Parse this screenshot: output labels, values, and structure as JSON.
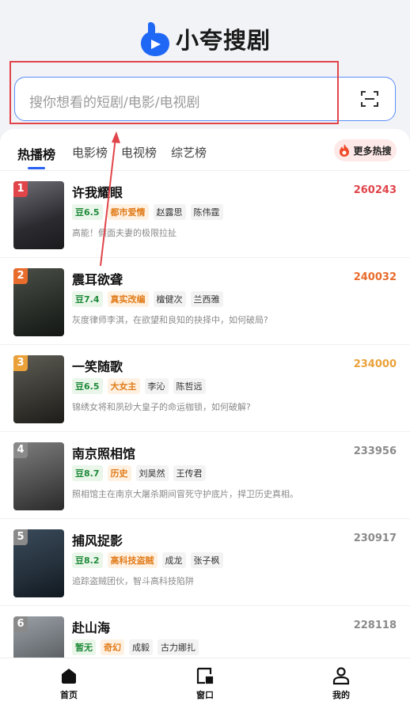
{
  "app": {
    "title": "小夸搜剧",
    "search_placeholder": "搜你想看的短剧/电影/电视剧"
  },
  "tabs": [
    {
      "label": "热播榜",
      "active": true
    },
    {
      "label": "电影榜",
      "active": false
    },
    {
      "label": "电视榜",
      "active": false
    },
    {
      "label": "综艺榜",
      "active": false
    }
  ],
  "more_hot_label": "更多热搜",
  "rank_colors": [
    "#e0454a",
    "#e86c2c",
    "#eaa13a",
    "#8a8a8a",
    "#8a8a8a",
    "#8a8a8a"
  ],
  "items": [
    {
      "rank": "1",
      "title": "许我耀眼",
      "score": "260243",
      "douban": "豆6.5",
      "genre": "都市爱情",
      "actors": [
        "赵露思",
        "陈伟霆"
      ],
      "desc": "高能！假面夫妻的极限拉扯",
      "score_color": "#e0454a"
    },
    {
      "rank": "2",
      "title": "震耳欲聋",
      "score": "240032",
      "douban": "豆7.4",
      "genre": "真实改编",
      "actors": [
        "檀健次",
        "兰西雅"
      ],
      "desc": "灰度律师李淇，在欲望和良知的抉择中，如何破局?",
      "score_color": "#e86c2c"
    },
    {
      "rank": "3",
      "title": "一笑随歌",
      "score": "234000",
      "douban": "豆6.5",
      "genre": "大女主",
      "actors": [
        "李沁",
        "陈哲远"
      ],
      "desc": "锦绣女将和夙砂大皇子的命运枷锁，如何破解?",
      "score_color": "#eaa13a"
    },
    {
      "rank": "4",
      "title": "南京照相馆",
      "score": "233956",
      "douban": "豆8.7",
      "genre": "历史",
      "actors": [
        "刘昊然",
        "王传君"
      ],
      "desc": "照相馆主在南京大屠杀期间冒死守护底片，捍卫历史真相。",
      "score_color": "#8a8a8a"
    },
    {
      "rank": "5",
      "title": "捕风捉影",
      "score": "230917",
      "douban": "豆8.2",
      "genre": "高科技盗贼",
      "actors": [
        "成龙",
        "张子枫"
      ],
      "desc": "追踪盗贼团伙，智斗高科技陷阱",
      "score_color": "#8a8a8a"
    },
    {
      "rank": "6",
      "title": "赴山海",
      "score": "228118",
      "douban": "暂无",
      "genre": "奇幻",
      "actors": [
        "成毅",
        "古力娜扎"
      ],
      "desc": "",
      "score_color": "#8a8a8a"
    }
  ],
  "bottom_nav": [
    {
      "label": "首页",
      "icon": "home-icon"
    },
    {
      "label": "窗口",
      "icon": "window-icon"
    },
    {
      "label": "我的",
      "icon": "profile-icon"
    }
  ]
}
